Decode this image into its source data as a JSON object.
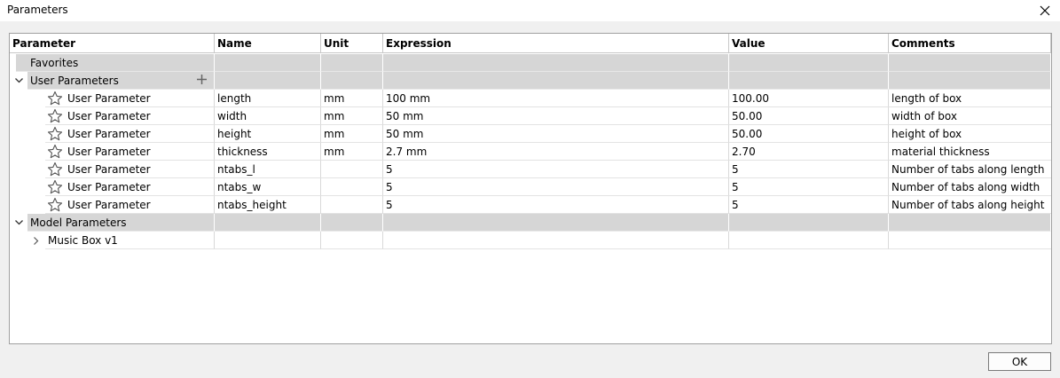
{
  "window": {
    "title": "Parameters"
  },
  "columns": [
    "Parameter",
    "Name",
    "Unit",
    "Expression",
    "Value",
    "Comments"
  ],
  "groups": {
    "favorites": "Favorites",
    "user": "User Parameters",
    "model": "Model Parameters"
  },
  "user_params": [
    {
      "type": "User Parameter",
      "name": "length",
      "unit": "mm",
      "expression": "100 mm",
      "value": "100.00",
      "comment": "length of box"
    },
    {
      "type": "User Parameter",
      "name": "width",
      "unit": "mm",
      "expression": "50 mm",
      "value": "50.00",
      "comment": "width of box"
    },
    {
      "type": "User Parameter",
      "name": "height",
      "unit": "mm",
      "expression": "50 mm",
      "value": "50.00",
      "comment": "height of box"
    },
    {
      "type": "User Parameter",
      "name": "thickness",
      "unit": "mm",
      "expression": "2.7 mm",
      "value": "2.70",
      "comment": "material thickness"
    },
    {
      "type": "User Parameter",
      "name": "ntabs_l",
      "unit": "",
      "expression": "5",
      "value": "5",
      "comment": "Number of tabs along length"
    },
    {
      "type": "User Parameter",
      "name": "ntabs_w",
      "unit": "",
      "expression": "5",
      "value": "5",
      "comment": "Number of tabs along width"
    },
    {
      "type": "User Parameter",
      "name": "ntabs_height",
      "unit": "",
      "expression": "5",
      "value": "5",
      "comment": "Number of tabs along height"
    }
  ],
  "model_items": [
    {
      "label": "Music Box v1"
    }
  ],
  "buttons": {
    "ok": "OK"
  },
  "icons": {
    "star": "star-icon",
    "plus": "plus-icon",
    "chevron_down": "chevron-down-icon",
    "chevron_right": "chevron-right-icon",
    "close": "close-icon"
  },
  "colors": {
    "group_bg": "#d6d6d6",
    "dialog_bg": "#f0f0f0"
  }
}
